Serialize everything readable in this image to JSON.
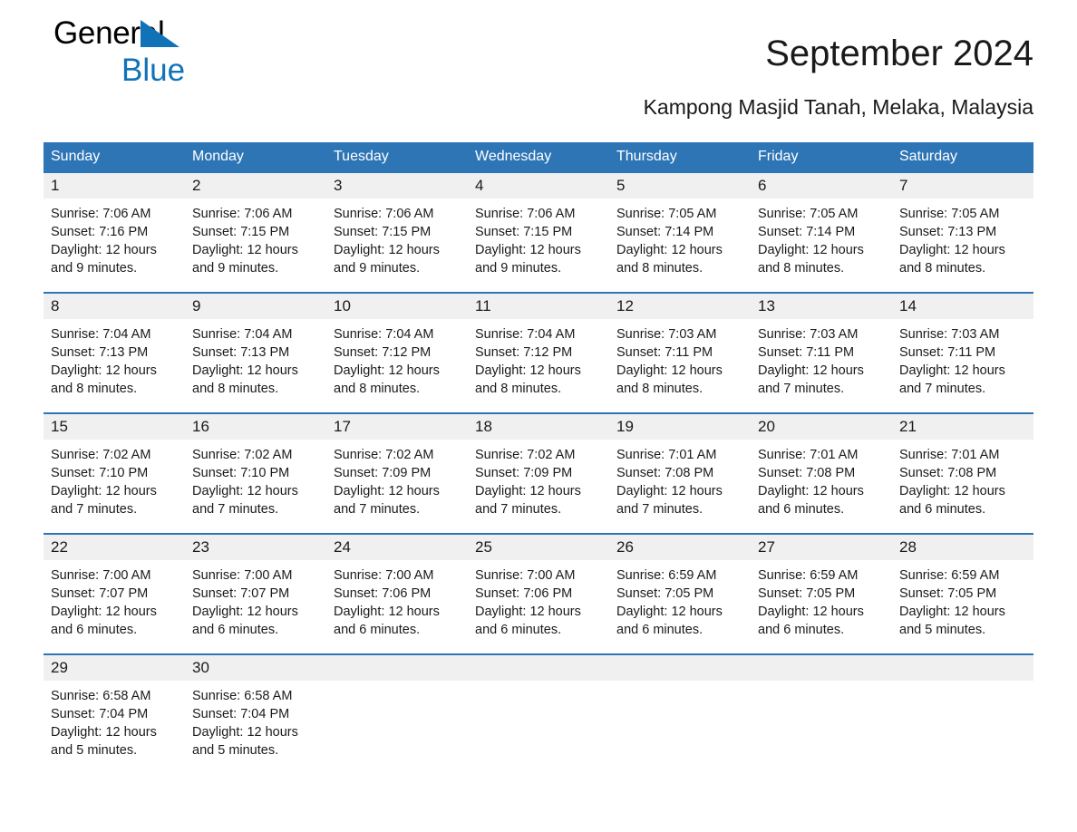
{
  "brand": {
    "name_part1": "General",
    "name_part2": "Blue",
    "triangle_color": "#1272b8"
  },
  "header": {
    "title": "September 2024",
    "subtitle": "Kampong Masjid Tanah, Melaka, Malaysia"
  },
  "calendar": {
    "header_bg": "#2e75b6",
    "daynum_bg": "#f0f0f0",
    "weekdays": [
      "Sunday",
      "Monday",
      "Tuesday",
      "Wednesday",
      "Thursday",
      "Friday",
      "Saturday"
    ],
    "weeks": [
      {
        "days": [
          {
            "num": "1",
            "sunrise": "Sunrise: 7:06 AM",
            "sunset": "Sunset: 7:16 PM",
            "daylight_line1": "Daylight: 12 hours",
            "daylight_line2": "and 9 minutes."
          },
          {
            "num": "2",
            "sunrise": "Sunrise: 7:06 AM",
            "sunset": "Sunset: 7:15 PM",
            "daylight_line1": "Daylight: 12 hours",
            "daylight_line2": "and 9 minutes."
          },
          {
            "num": "3",
            "sunrise": "Sunrise: 7:06 AM",
            "sunset": "Sunset: 7:15 PM",
            "daylight_line1": "Daylight: 12 hours",
            "daylight_line2": "and 9 minutes."
          },
          {
            "num": "4",
            "sunrise": "Sunrise: 7:06 AM",
            "sunset": "Sunset: 7:15 PM",
            "daylight_line1": "Daylight: 12 hours",
            "daylight_line2": "and 9 minutes."
          },
          {
            "num": "5",
            "sunrise": "Sunrise: 7:05 AM",
            "sunset": "Sunset: 7:14 PM",
            "daylight_line1": "Daylight: 12 hours",
            "daylight_line2": "and 8 minutes."
          },
          {
            "num": "6",
            "sunrise": "Sunrise: 7:05 AM",
            "sunset": "Sunset: 7:14 PM",
            "daylight_line1": "Daylight: 12 hours",
            "daylight_line2": "and 8 minutes."
          },
          {
            "num": "7",
            "sunrise": "Sunrise: 7:05 AM",
            "sunset": "Sunset: 7:13 PM",
            "daylight_line1": "Daylight: 12 hours",
            "daylight_line2": "and 8 minutes."
          }
        ]
      },
      {
        "days": [
          {
            "num": "8",
            "sunrise": "Sunrise: 7:04 AM",
            "sunset": "Sunset: 7:13 PM",
            "daylight_line1": "Daylight: 12 hours",
            "daylight_line2": "and 8 minutes."
          },
          {
            "num": "9",
            "sunrise": "Sunrise: 7:04 AM",
            "sunset": "Sunset: 7:13 PM",
            "daylight_line1": "Daylight: 12 hours",
            "daylight_line2": "and 8 minutes."
          },
          {
            "num": "10",
            "sunrise": "Sunrise: 7:04 AM",
            "sunset": "Sunset: 7:12 PM",
            "daylight_line1": "Daylight: 12 hours",
            "daylight_line2": "and 8 minutes."
          },
          {
            "num": "11",
            "sunrise": "Sunrise: 7:04 AM",
            "sunset": "Sunset: 7:12 PM",
            "daylight_line1": "Daylight: 12 hours",
            "daylight_line2": "and 8 minutes."
          },
          {
            "num": "12",
            "sunrise": "Sunrise: 7:03 AM",
            "sunset": "Sunset: 7:11 PM",
            "daylight_line1": "Daylight: 12 hours",
            "daylight_line2": "and 8 minutes."
          },
          {
            "num": "13",
            "sunrise": "Sunrise: 7:03 AM",
            "sunset": "Sunset: 7:11 PM",
            "daylight_line1": "Daylight: 12 hours",
            "daylight_line2": "and 7 minutes."
          },
          {
            "num": "14",
            "sunrise": "Sunrise: 7:03 AM",
            "sunset": "Sunset: 7:11 PM",
            "daylight_line1": "Daylight: 12 hours",
            "daylight_line2": "and 7 minutes."
          }
        ]
      },
      {
        "days": [
          {
            "num": "15",
            "sunrise": "Sunrise: 7:02 AM",
            "sunset": "Sunset: 7:10 PM",
            "daylight_line1": "Daylight: 12 hours",
            "daylight_line2": "and 7 minutes."
          },
          {
            "num": "16",
            "sunrise": "Sunrise: 7:02 AM",
            "sunset": "Sunset: 7:10 PM",
            "daylight_line1": "Daylight: 12 hours",
            "daylight_line2": "and 7 minutes."
          },
          {
            "num": "17",
            "sunrise": "Sunrise: 7:02 AM",
            "sunset": "Sunset: 7:09 PM",
            "daylight_line1": "Daylight: 12 hours",
            "daylight_line2": "and 7 minutes."
          },
          {
            "num": "18",
            "sunrise": "Sunrise: 7:02 AM",
            "sunset": "Sunset: 7:09 PM",
            "daylight_line1": "Daylight: 12 hours",
            "daylight_line2": "and 7 minutes."
          },
          {
            "num": "19",
            "sunrise": "Sunrise: 7:01 AM",
            "sunset": "Sunset: 7:08 PM",
            "daylight_line1": "Daylight: 12 hours",
            "daylight_line2": "and 7 minutes."
          },
          {
            "num": "20",
            "sunrise": "Sunrise: 7:01 AM",
            "sunset": "Sunset: 7:08 PM",
            "daylight_line1": "Daylight: 12 hours",
            "daylight_line2": "and 6 minutes."
          },
          {
            "num": "21",
            "sunrise": "Sunrise: 7:01 AM",
            "sunset": "Sunset: 7:08 PM",
            "daylight_line1": "Daylight: 12 hours",
            "daylight_line2": "and 6 minutes."
          }
        ]
      },
      {
        "days": [
          {
            "num": "22",
            "sunrise": "Sunrise: 7:00 AM",
            "sunset": "Sunset: 7:07 PM",
            "daylight_line1": "Daylight: 12 hours",
            "daylight_line2": "and 6 minutes."
          },
          {
            "num": "23",
            "sunrise": "Sunrise: 7:00 AM",
            "sunset": "Sunset: 7:07 PM",
            "daylight_line1": "Daylight: 12 hours",
            "daylight_line2": "and 6 minutes."
          },
          {
            "num": "24",
            "sunrise": "Sunrise: 7:00 AM",
            "sunset": "Sunset: 7:06 PM",
            "daylight_line1": "Daylight: 12 hours",
            "daylight_line2": "and 6 minutes."
          },
          {
            "num": "25",
            "sunrise": "Sunrise: 7:00 AM",
            "sunset": "Sunset: 7:06 PM",
            "daylight_line1": "Daylight: 12 hours",
            "daylight_line2": "and 6 minutes."
          },
          {
            "num": "26",
            "sunrise": "Sunrise: 6:59 AM",
            "sunset": "Sunset: 7:05 PM",
            "daylight_line1": "Daylight: 12 hours",
            "daylight_line2": "and 6 minutes."
          },
          {
            "num": "27",
            "sunrise": "Sunrise: 6:59 AM",
            "sunset": "Sunset: 7:05 PM",
            "daylight_line1": "Daylight: 12 hours",
            "daylight_line2": "and 6 minutes."
          },
          {
            "num": "28",
            "sunrise": "Sunrise: 6:59 AM",
            "sunset": "Sunset: 7:05 PM",
            "daylight_line1": "Daylight: 12 hours",
            "daylight_line2": "and 5 minutes."
          }
        ]
      },
      {
        "days": [
          {
            "num": "29",
            "sunrise": "Sunrise: 6:58 AM",
            "sunset": "Sunset: 7:04 PM",
            "daylight_line1": "Daylight: 12 hours",
            "daylight_line2": "and 5 minutes."
          },
          {
            "num": "30",
            "sunrise": "Sunrise: 6:58 AM",
            "sunset": "Sunset: 7:04 PM",
            "daylight_line1": "Daylight: 12 hours",
            "daylight_line2": "and 5 minutes."
          },
          {
            "num": "",
            "sunrise": "",
            "sunset": "",
            "daylight_line1": "",
            "daylight_line2": ""
          },
          {
            "num": "",
            "sunrise": "",
            "sunset": "",
            "daylight_line1": "",
            "daylight_line2": ""
          },
          {
            "num": "",
            "sunrise": "",
            "sunset": "",
            "daylight_line1": "",
            "daylight_line2": ""
          },
          {
            "num": "",
            "sunrise": "",
            "sunset": "",
            "daylight_line1": "",
            "daylight_line2": ""
          },
          {
            "num": "",
            "sunrise": "",
            "sunset": "",
            "daylight_line1": "",
            "daylight_line2": ""
          }
        ]
      }
    ]
  }
}
